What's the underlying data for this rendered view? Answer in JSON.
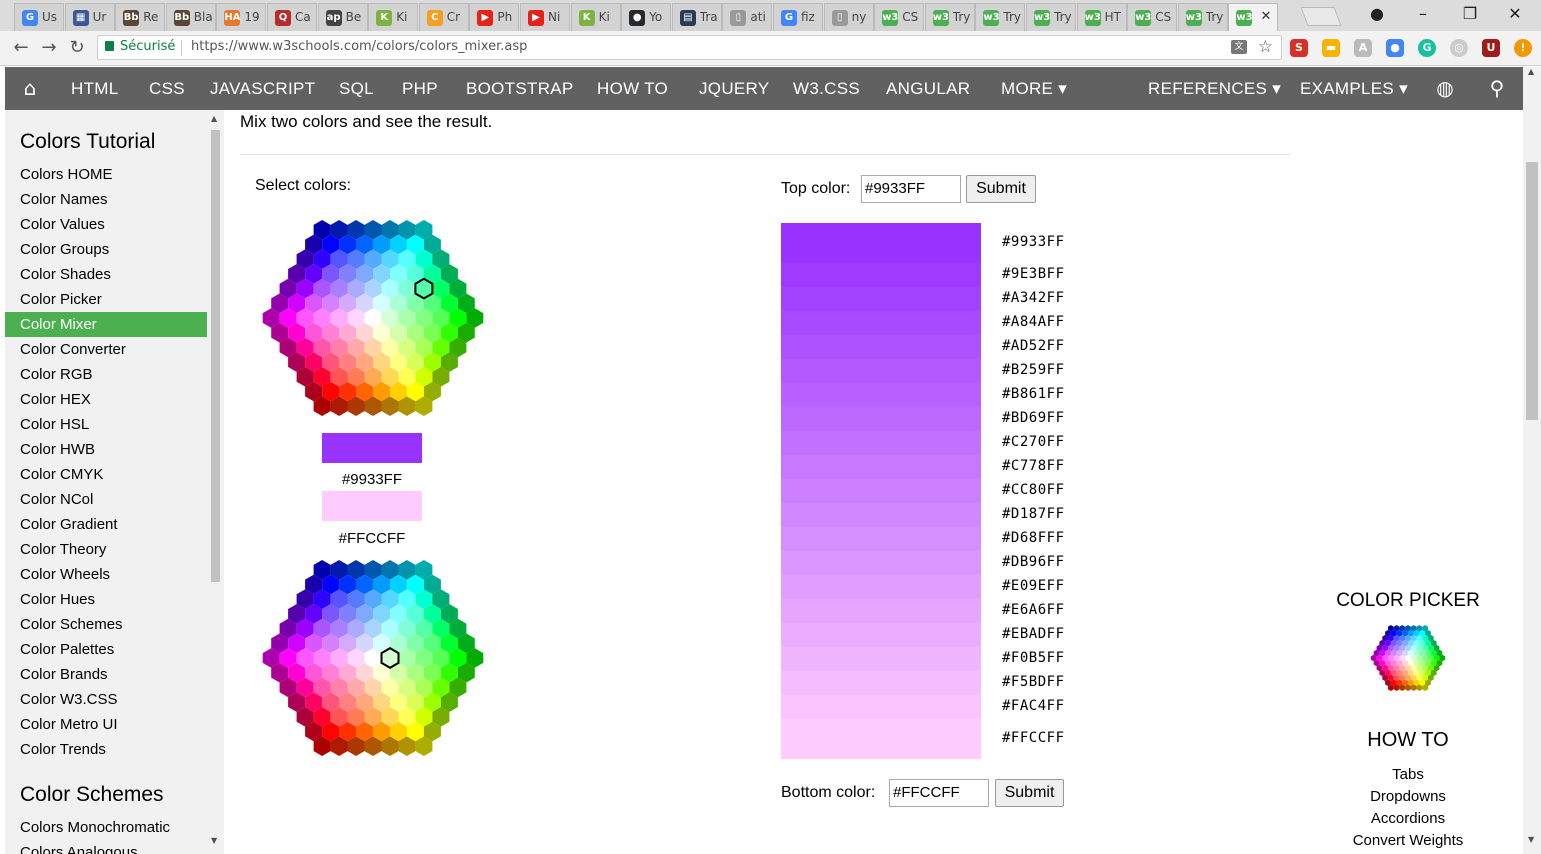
{
  "browser": {
    "tabs": [
      {
        "favicon": "G",
        "color": "#4285f4",
        "label": "Us"
      },
      {
        "favicon": "▦",
        "color": "#3b5998",
        "label": "Ur"
      },
      {
        "favicon": "Bb",
        "color": "#5b4636",
        "label": "Re"
      },
      {
        "favicon": "Bb",
        "color": "#5b4636",
        "label": "Bla"
      },
      {
        "favicon": "HA",
        "color": "#e8792c",
        "label": "19"
      },
      {
        "favicon": "Q",
        "color": "#b92b27",
        "label": "Ca"
      },
      {
        "favicon": "ap",
        "color": "#444444",
        "label": "Be"
      },
      {
        "favicon": "K",
        "color": "#7cb342",
        "label": "Ki"
      },
      {
        "favicon": "C",
        "color": "#f4a021",
        "label": "Cr"
      },
      {
        "favicon": "▶",
        "color": "#e62117",
        "label": "Ph"
      },
      {
        "favicon": "▶",
        "color": "#e62117",
        "label": "Ni"
      },
      {
        "favicon": "K",
        "color": "#7cb342",
        "label": "Ki"
      },
      {
        "favicon": "●",
        "color": "#24292e",
        "label": "Yo"
      },
      {
        "favicon": "▤",
        "color": "#2b3a55",
        "label": "Tra"
      },
      {
        "favicon": "▯",
        "color": "#999999",
        "label": "ati"
      },
      {
        "favicon": "G",
        "color": "#4285f4",
        "label": "fiz"
      },
      {
        "favicon": "▯",
        "color": "#999999",
        "label": "ny"
      },
      {
        "favicon": "w3",
        "color": "#4CAF50",
        "label": "CS"
      },
      {
        "favicon": "w3",
        "color": "#4CAF50",
        "label": "Try"
      },
      {
        "favicon": "w3",
        "color": "#4CAF50",
        "label": "Try"
      },
      {
        "favicon": "w3",
        "color": "#4CAF50",
        "label": "Try"
      },
      {
        "favicon": "w3",
        "color": "#4CAF50",
        "label": "HT"
      },
      {
        "favicon": "w3",
        "color": "#4CAF50",
        "label": "CS"
      },
      {
        "favicon": "w3",
        "color": "#4CAF50",
        "label": "Try"
      },
      {
        "favicon": "w3",
        "color": "#4CAF50",
        "label": "",
        "active": true
      }
    ],
    "secure_label": "Sécurisé",
    "url": "https://www.w3schools.com/colors/colors_mixer.asp"
  },
  "nav": {
    "items": [
      "HTML",
      "CSS",
      "JAVASCRIPT",
      "SQL",
      "PHP",
      "BOOTSTRAP",
      "HOW TO",
      "JQUERY",
      "W3.CSS",
      "ANGULAR",
      "MORE ▾"
    ],
    "right_items": [
      "REFERENCES ▾",
      "EXAMPLES ▾"
    ]
  },
  "sidebar": {
    "heading": "Colors Tutorial",
    "items": [
      "Colors HOME",
      "Color Names",
      "Color Values",
      "Color Groups",
      "Color Shades",
      "Color Picker",
      "Color Mixer",
      "Color Converter",
      "Color RGB",
      "Color HEX",
      "Color HSL",
      "Color HWB",
      "Color CMYK",
      "Color NCol",
      "Color Gradient",
      "Color Theory",
      "Color Wheels",
      "Color Hues",
      "Color Schemes",
      "Color Palettes",
      "Color Brands",
      "Color W3.CSS",
      "Color Metro UI",
      "Color Trends"
    ],
    "active_item": "Color Mixer",
    "heading2": "Color Schemes",
    "items2": [
      "Colors Monochromatic",
      "Colors Analogous"
    ]
  },
  "main": {
    "intro": "Mix two colors and see the result.",
    "select_label": "Select colors:",
    "top_color": "#9933FF",
    "bottom_color": "#FFCCFF",
    "top_label": "Top color:",
    "bottom_label": "Bottom color:",
    "submit_label": "Submit",
    "mix_steps": [
      "#9933FF",
      "#9E3BFF",
      "#A342FF",
      "#A84AFF",
      "#AD52FF",
      "#B259FF",
      "#B861FF",
      "#BD69FF",
      "#C270FF",
      "#C778FF",
      "#CC80FF",
      "#D187FF",
      "#D68FFF",
      "#DB96FF",
      "#E09EFF",
      "#E6A6FF",
      "#EBADFF",
      "#F0B5FF",
      "#F5BDFF",
      "#FAC4FF",
      "#FFCCFF"
    ]
  },
  "right": {
    "picker_title": "COLOR PICKER",
    "howto_title": "HOW TO",
    "howto_links": [
      "Tabs",
      "Dropdowns",
      "Accordions",
      "Convert Weights"
    ]
  }
}
